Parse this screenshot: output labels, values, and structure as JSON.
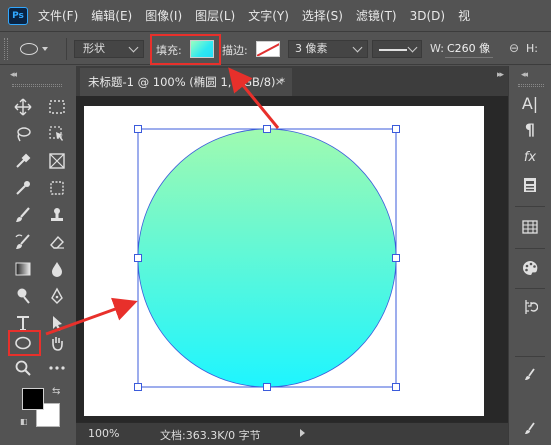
{
  "menubar": {
    "logo": "Ps",
    "items": [
      "文件(F)",
      "编辑(E)",
      "图像(I)",
      "图层(L)",
      "文字(Y)",
      "选择(S)",
      "滤镜(T)",
      "3D(D)",
      "视"
    ]
  },
  "options": {
    "mode": "形状",
    "fill_label": "填充:",
    "fill_gradient": [
      "#9affc0",
      "#22ddf7"
    ],
    "stroke_label": "描边:",
    "stroke_width": "3 像素",
    "w_label": "W:",
    "w_value": "C260 像",
    "h_label": "H:"
  },
  "document": {
    "tab_title": "未标题-1 @ 100% (椭圆 1, RGB/8) *",
    "close": "×"
  },
  "canvas": {
    "background": "#ffffff",
    "ellipse_gradient_top": "#a0fab0",
    "ellipse_gradient_bottom": "#1ef5ff",
    "bounding_box_color": "#3b5bdb",
    "annotation_color": "#e8302b"
  },
  "status": {
    "zoom": "100%",
    "doc_info": "文档:363.3K/0 字节"
  },
  "toolbar": {
    "tools": [
      "move-icon",
      "marquee-icon",
      "lasso-icon",
      "object-select-icon",
      "eyedropper-icon",
      "frame-icon",
      "crop-eyedropper-icon",
      "patch-icon",
      "brush-icon",
      "stamp-icon",
      "history-brush-icon",
      "eraser-icon",
      "gradient-icon",
      "drop-icon",
      "dodge-icon",
      "pen-icon",
      "type-icon",
      "path-select-icon",
      "ellipse-icon",
      "hand-icon",
      "zoom-icon",
      "more-icon"
    ],
    "foreground": "#000000",
    "background": "#ffffff"
  },
  "right_panel": {
    "icons": [
      "character-icon",
      "paragraph-icon",
      "fx-icon",
      "properties-icon",
      "table-icon",
      "color-palette-icon",
      "history-icon",
      "brush-panel-icon"
    ]
  }
}
